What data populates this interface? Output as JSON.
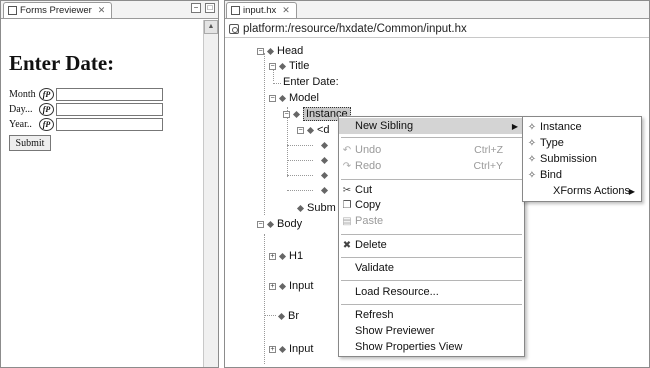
{
  "left_view": {
    "tab_label": "Forms Previewer",
    "tab_close": "✕",
    "controls": [
      "−",
      "□"
    ],
    "form": {
      "heading": "Enter Date:",
      "fields": [
        {
          "label": "Month",
          "badge": "fP",
          "value": ""
        },
        {
          "label": "Day...",
          "badge": "fP",
          "value": ""
        },
        {
          "label": "Year..",
          "badge": "fP",
          "value": ""
        }
      ],
      "submit_label": "Submit"
    }
  },
  "editor": {
    "tab_label": "input.hx",
    "tab_close": "✕",
    "path": "platform:/resource/hxdate/Common/input.hx",
    "tree": {
      "head": "Head",
      "title": "Title",
      "title_text": "Enter Date:",
      "model": "Model",
      "instance": "Instance",
      "date_child": "<d",
      "submission": "Subm",
      "body": "Body",
      "h1": "H1",
      "input1": "Input",
      "br": "Br",
      "input2": "Input"
    }
  },
  "context_menu": {
    "new_sibling": "New Sibling",
    "undo": "Undo",
    "undo_shortcut": "Ctrl+Z",
    "redo": "Redo",
    "redo_shortcut": "Ctrl+Y",
    "cut": "Cut",
    "copy": "Copy",
    "paste": "Paste",
    "delete": "Delete",
    "validate": "Validate",
    "load_resource": "Load Resource...",
    "refresh": "Refresh",
    "show_previewer": "Show Previewer",
    "show_properties": "Show Properties View"
  },
  "submenu": {
    "instance": "Instance",
    "type": "Type",
    "submission": "Submission",
    "bind": "Bind",
    "xforms_actions": "XForms Actions"
  },
  "icons": {
    "arrow_right": "▶",
    "up_arrow": "▲"
  },
  "colors": {
    "highlight": "#d4d4d4",
    "disabled_text": "#9a9a9a"
  }
}
